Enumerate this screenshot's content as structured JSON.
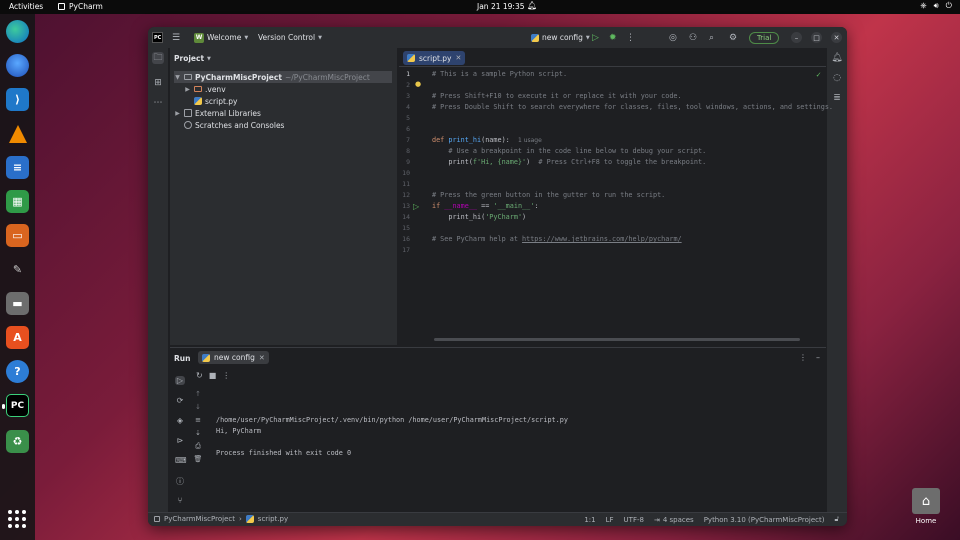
{
  "topbar": {
    "activities": "Activities",
    "app_name": "PyCharm",
    "clock": "Jan 21  19:35"
  },
  "dock": {
    "items": [
      "edge",
      "thunderbird",
      "vscode",
      "vlc",
      "writer",
      "calc",
      "impress",
      "gimp",
      "files",
      "app-center",
      "help",
      "pycharm",
      "trash"
    ],
    "active": "pycharm"
  },
  "desktop": {
    "home_label": "Home"
  },
  "ide": {
    "titlebar": {
      "project_badge": "W",
      "project_menu": "Welcome",
      "vcs_menu": "Version Control",
      "run_config": "new config",
      "trial_button": "Trial"
    },
    "project_panel": {
      "title": "Project",
      "root_name": "PyCharmMiscProject",
      "root_path": "~/PyCharmMiscProject",
      "venv": ".venv",
      "file": "script.py",
      "external_libraries": "External Libraries",
      "scratches": "Scratches and Consoles"
    },
    "editor": {
      "tab_name": "script.py",
      "line_numbers": [
        "1",
        "2",
        "3",
        "4",
        "5",
        "6",
        "7",
        "8",
        "9",
        "10",
        "11",
        "12",
        "13",
        "14",
        "15",
        "16",
        "17"
      ],
      "usage_hint": "1 usage",
      "lines": {
        "l1": "# This is a sample Python script.",
        "l3": "# Press Shift+F10 to execute it or replace it with your code.",
        "l4": "# Press Double Shift to search everywhere for classes, files, tool windows, actions, and settings.",
        "l7_kw": "def ",
        "l7_fn": "print_hi",
        "l7_rest": "(name):",
        "l8": "    # Use a breakpoint in the code line below to debug your script.",
        "l9_a": "    print(",
        "l9_str": "f'Hi, {name}'",
        "l9_b": ")  ",
        "l9_cm": "# Press Ctrl+F8 to toggle the breakpoint.",
        "l12": "# Press the green button in the gutter to run the script.",
        "l13_kw": "if ",
        "l13_dm": "__name__",
        "l13_op": " == ",
        "l13_str": "'__main__'",
        "l13_end": ":",
        "l14_a": "    print_hi(",
        "l14_str": "'PyCharm'",
        "l14_b": ")",
        "l16_cm": "# See PyCharm help at ",
        "l16_link": "https://www.jetbrains.com/help/pycharm/"
      }
    },
    "run_panel": {
      "title": "Run",
      "tab": "new config",
      "output": [
        "/home/user/PyCharmMiscProject/.venv/bin/python /home/user/PyCharmMiscProject/script.py",
        "Hi, PyCharm",
        "",
        "Process finished with exit code 0"
      ]
    },
    "statusbar": {
      "breadcrumb_project": "PyCharmMiscProject",
      "breadcrumb_file": "script.py",
      "position": "1:1",
      "line_sep": "LF",
      "encoding": "UTF-8",
      "indent": "4 spaces",
      "interpreter": "Python 3.10 (PyCharmMiscProject)"
    }
  }
}
